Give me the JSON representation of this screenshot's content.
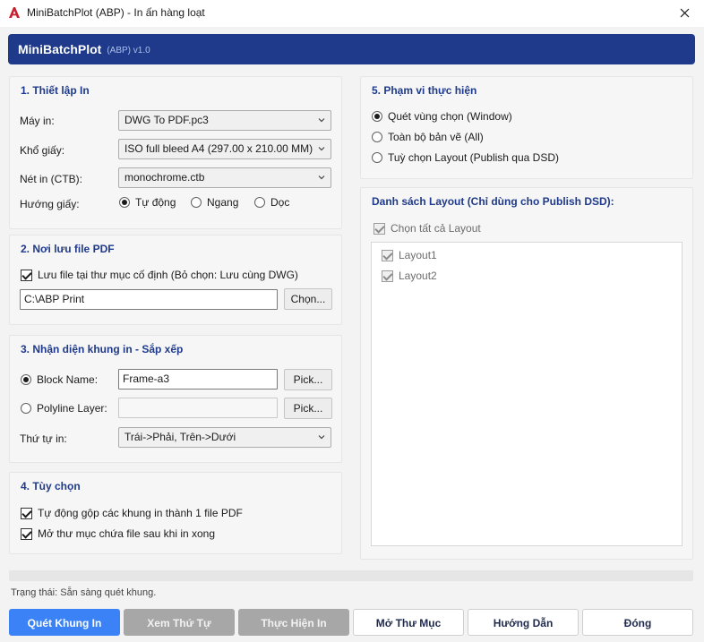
{
  "window": {
    "title": "MiniBatchPlot (ABP) - In ấn hàng loạt",
    "close_glyph": "✕"
  },
  "header": {
    "title": "MiniBatchPlot",
    "version": "(ABP) v1.0",
    "color": "#1f3a8a"
  },
  "print_setup": {
    "title": "1. Thiết lập In",
    "printer_label": "Máy in:",
    "printer_value": "DWG To PDF.pc3",
    "paper_label": "Khổ giấy:",
    "paper_value": "ISO full bleed A4 (297.00 x 210.00 MM)",
    "ctb_label": "Nét in (CTB):",
    "ctb_value": "monochrome.ctb",
    "orientation_label": "Hướng giấy:",
    "orientation_options": [
      "Tự động",
      "Ngang",
      "Dọc"
    ],
    "orientation_selected": "Tự động"
  },
  "save_location": {
    "title": "2. Nơi lưu file PDF",
    "fixed_folder_label": "Lưu file tại thư mục cố định (Bỏ chọn: Lưu cùng DWG)",
    "fixed_folder_checked": true,
    "path_value": "C:\\ABP Print",
    "browse_label": "Chọn..."
  },
  "frame_detect": {
    "title": "3. Nhận diện khung in - Sắp xếp",
    "block_name_label": "Block Name:",
    "block_name_value": "Frame-a3",
    "block_selected": true,
    "polyline_label": "Polyline Layer:",
    "polyline_value": "",
    "pick_label": "Pick...",
    "order_label": "Thứ tự in:",
    "order_value": "Trái->Phải, Trên->Dưới"
  },
  "options": {
    "title": "4. Tùy chọn",
    "merge_label": "Tự động gộp các khung in thành 1 file PDF",
    "merge_checked": true,
    "open_folder_label": "Mở thư mục chứa file sau khi in xong",
    "open_folder_checked": true
  },
  "scope": {
    "title": "5. Phạm vi thực hiện",
    "options": [
      "Quét vùng chọn (Window)",
      "Toàn bộ bản vẽ (All)",
      "Tuỳ chọn Layout (Publish qua DSD)"
    ],
    "selected": "Quét vùng chọn (Window)"
  },
  "layouts": {
    "title": "Danh sách Layout (Chỉ dùng cho Publish DSD):",
    "select_all_label": "Chọn tất cả Layout",
    "items": [
      "Layout1",
      "Layout2"
    ]
  },
  "progress": {
    "value": 0
  },
  "status": {
    "text": "Trạng thái: Sẵn sàng quét khung."
  },
  "actions": {
    "scan": "Quét Khung In",
    "preview": "Xem Thứ Tự",
    "run": "Thực Hiện In",
    "open_folder": "Mở Thư Mục",
    "help": "Hướng Dẫn",
    "close": "Đóng"
  },
  "colors": {
    "primary_button": "#3b82f6",
    "disabled_button": "#a7a7a7",
    "group_title": "#1f3a8a"
  }
}
